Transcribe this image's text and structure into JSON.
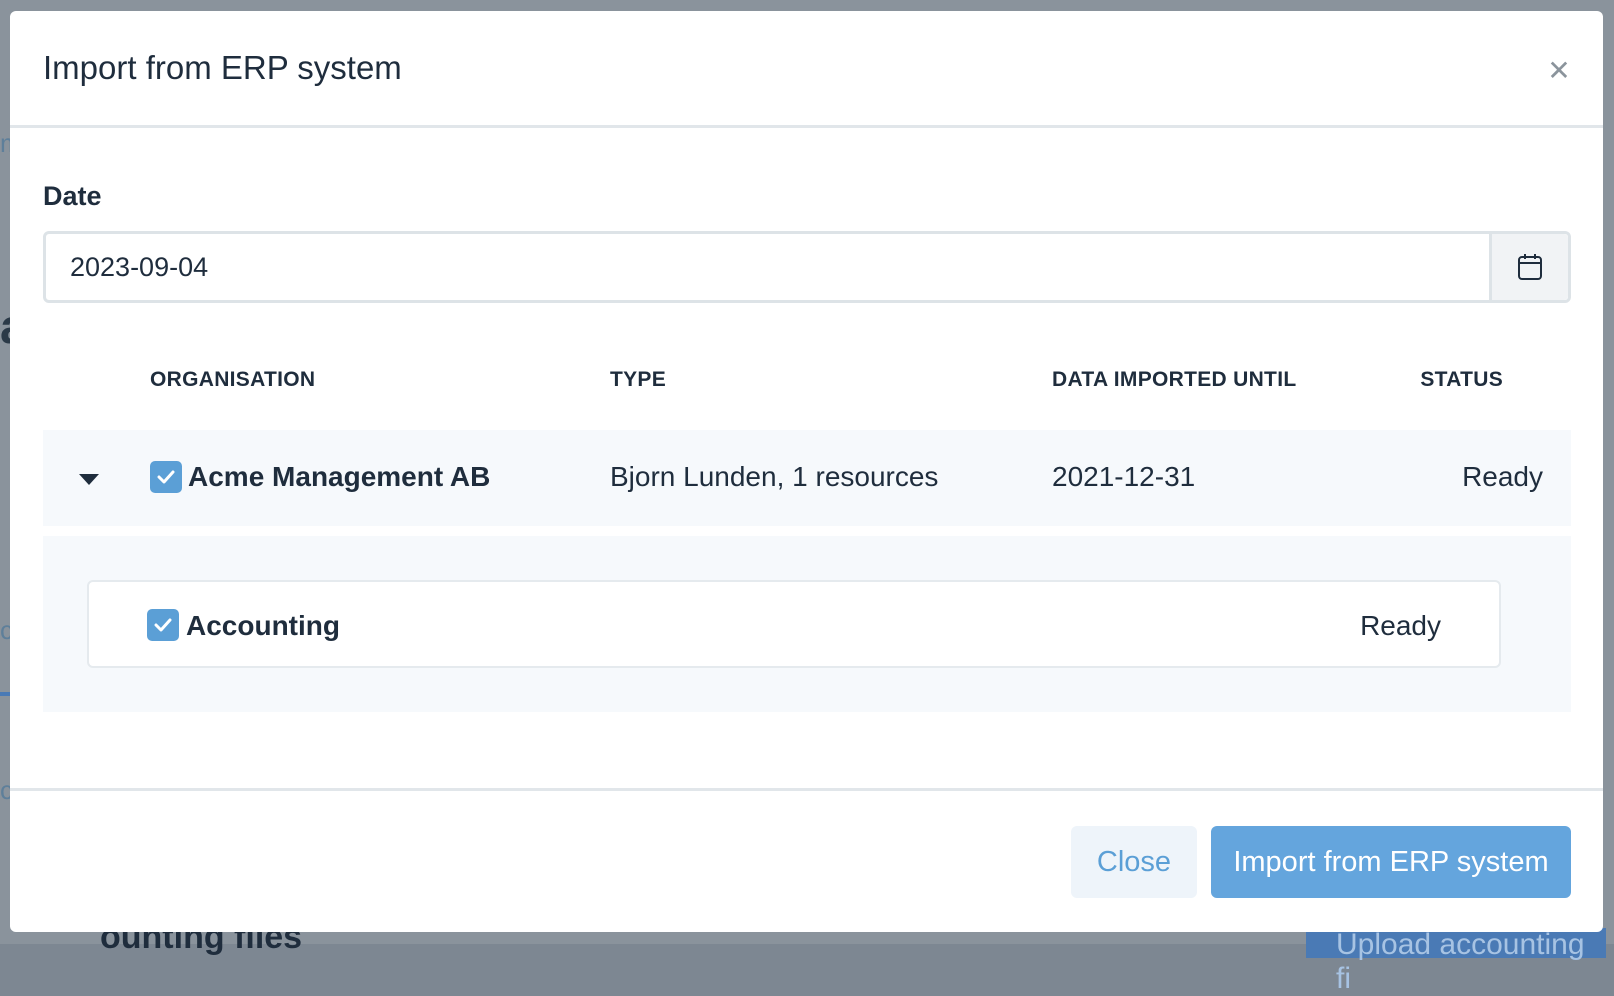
{
  "background": {
    "snippet_1": "m",
    "snippet_2": "a",
    "snippet_3": "c",
    "snippet_4": "c",
    "bottom_text": "ounting files",
    "bottom_button": "Upload accounting fi"
  },
  "modal": {
    "title": "Import from ERP system",
    "close_icon": "close-icon"
  },
  "date": {
    "label": "Date",
    "value": "2023-09-04",
    "icon": "calendar-icon"
  },
  "table": {
    "headers": {
      "organisation": "ORGANISATION",
      "type": "TYPE",
      "imported_until": "DATA IMPORTED UNTIL",
      "status": "STATUS"
    },
    "rows": [
      {
        "organisation": "Acme Management AB",
        "type": "Bjorn Lunden, 1 resources",
        "imported_until": "2021-12-31",
        "status": "Ready",
        "checked": true,
        "expanded": true,
        "resources": [
          {
            "name": "Accounting",
            "status": "Ready",
            "checked": true
          }
        ]
      }
    ]
  },
  "footer": {
    "close_label": "Close",
    "import_label": "Import from ERP system"
  },
  "colors": {
    "accent": "#64a5dd",
    "checkbox": "#5b9fd6",
    "text": "#1f2d3d"
  }
}
